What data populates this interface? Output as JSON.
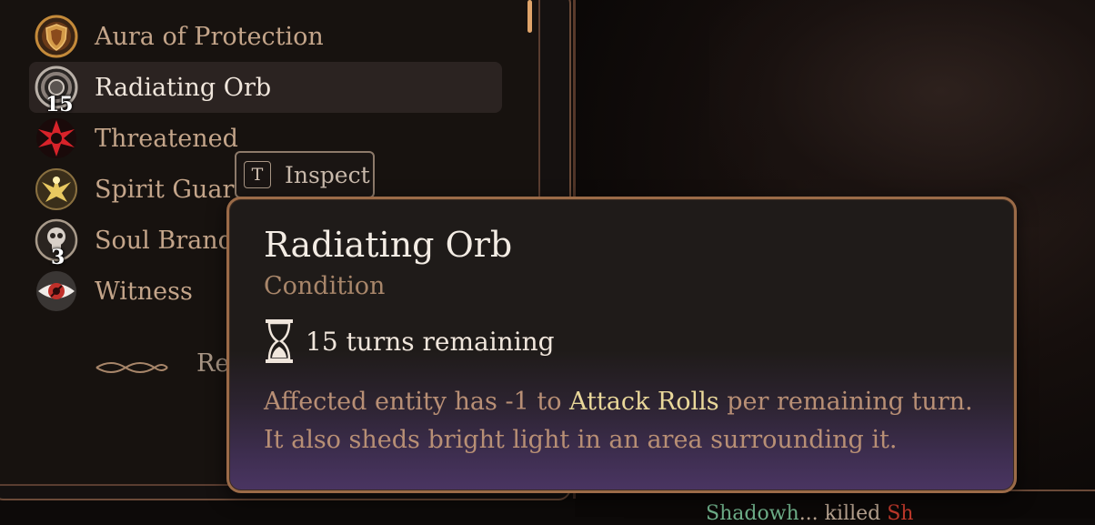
{
  "conditions": [
    {
      "label": "Aura of Protection",
      "badge": "",
      "icon": "shield-icon"
    },
    {
      "label": "Radiating Orb",
      "badge": "15",
      "icon": "orb-icon"
    },
    {
      "label": "Threatened",
      "badge": "",
      "icon": "threatened-icon"
    },
    {
      "label": "Spirit Guardi",
      "badge": "",
      "icon": "spirit-guardians-icon"
    },
    {
      "label": "Soul Brandi",
      "badge": "3",
      "icon": "skull-icon"
    },
    {
      "label": "Witness",
      "badge": "",
      "icon": "eye-icon"
    }
  ],
  "selected_index": 1,
  "panel_footer_text": "Re",
  "inspect": {
    "key": "T",
    "label": "Inspect"
  },
  "tooltip": {
    "title": "Radiating Orb",
    "type": "Condition",
    "turns": "15 turns remaining",
    "desc_pre": "Affected entity has -1 to ",
    "desc_highlight": "Attack Rolls",
    "desc_post": " per remaining turn. It also sheds bright light in an area surrounding it."
  },
  "combat_log": {
    "green": "Shadowh",
    "white": "... killed ",
    "red": "Sh"
  },
  "colors": {
    "accent_gold": "#9b6b48",
    "highlight": "#ead89a",
    "text_muted": "#b88f75",
    "threatened_red": "#d8232a"
  }
}
